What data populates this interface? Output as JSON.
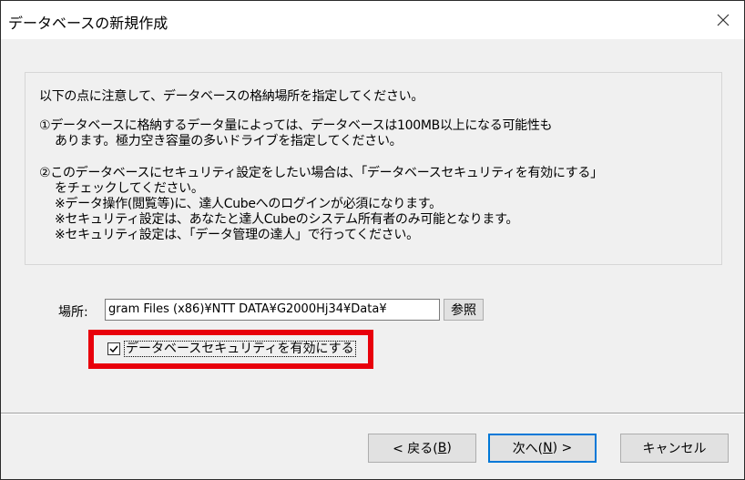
{
  "window": {
    "title": "データベースの新規作成",
    "close_glyph": "✕"
  },
  "info": {
    "intro": "以下の点に注意して、データベースの格納場所を指定してください。",
    "note1_line1": "①データベースに格納するデータ量によっては、データベースは100MB以上になる可能性も",
    "note1_line2": "あります。極力空き容量の多いドライブを指定してください。",
    "note2_line1": "②このデータベースにセキュリティ設定をしたい場合は、「データベースセキュリティを有効にする」",
    "note2_line2": "をチェックしてください。",
    "note2_line3": "※データ操作(閲覧等)に、達人Cubeへのログインが必須になります。",
    "note2_line4": "※セキュリティ設定は、あなたと達人Cubeのシステム所有者のみ可能となります。",
    "note2_line5": "※セキュリティ設定は、「データ管理の達人」で行ってください。"
  },
  "location": {
    "label": "場所:",
    "path_value": "gram Files (x86)¥NTT DATA¥G2000Hj34¥Data¥",
    "browse_label": "参照"
  },
  "security": {
    "checkbox_label": "データベースセキュリティを有効にする",
    "checked": true,
    "highlight_color": "#e8000b"
  },
  "buttons": {
    "back_label": "< 戻る(",
    "back_accel": "B",
    "back_suffix": ")",
    "next_label": "次へ(",
    "next_accel": "N",
    "next_suffix": ") >",
    "cancel_label": "キャンセル"
  },
  "colors": {
    "dialog_bg": "#f0f0f0",
    "default_button_border": "#0078d7"
  }
}
